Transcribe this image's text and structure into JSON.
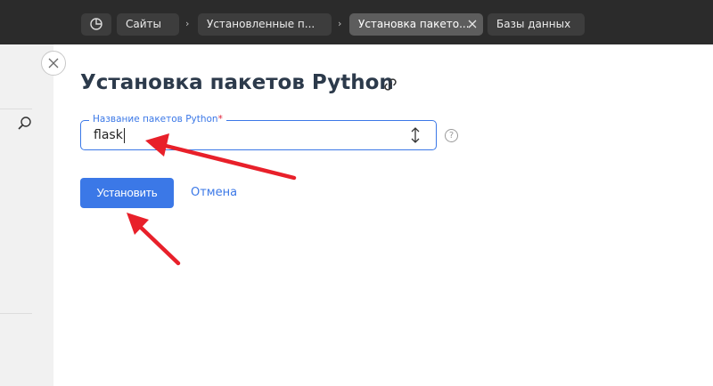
{
  "breadcrumbs": [
    {
      "label": "Сайты"
    },
    {
      "label": "Установленные п..."
    },
    {
      "label": "Установка пакето..."
    },
    {
      "label": "Базы данных"
    }
  ],
  "page": {
    "title": "Установка пакетов Python"
  },
  "form": {
    "field_label": "Название пакетов Python",
    "required_mark": "*",
    "field_value": "flask",
    "help_label": "?"
  },
  "actions": {
    "install_label": "Установить",
    "cancel_label": "Отмена"
  },
  "colors": {
    "accent": "#3b78e7",
    "arrow": "#e8202a",
    "topbar": "#2b2b2b"
  }
}
